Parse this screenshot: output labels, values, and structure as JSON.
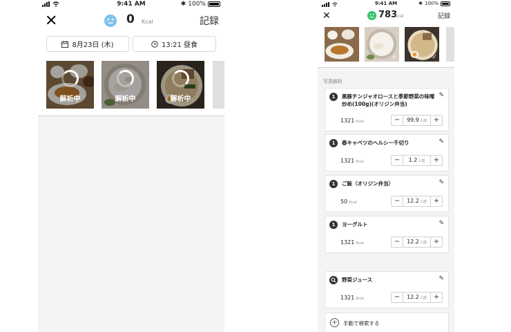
{
  "status": {
    "time": "9:41 AM",
    "battery": "100%"
  },
  "screen1": {
    "close_icon": "✕",
    "kcal_value": "0",
    "kcal_unit": "Kcal",
    "record_label": "記録",
    "date_label": "8月23日 (木)",
    "time_label": "13:21 昼食",
    "thumbnails": [
      {
        "label": "解析中"
      },
      {
        "label": "解析中"
      },
      {
        "label": "解析中"
      }
    ]
  },
  "screen2": {
    "close_icon": "✕",
    "kcal_value": "783",
    "kcal_unit": "Kcal",
    "record_label": "記録",
    "section_label": "写真解析",
    "items": [
      {
        "badge": "1",
        "name": "黒豚チンジャオロースと季節野菜の味噌炒め(100g)(オリジン弁当)",
        "kcal": "1321",
        "kcal_unit": "Kcal",
        "amount": "99.9",
        "amount_unit": "人前"
      },
      {
        "badge": "1",
        "name": "春キャベツのヘルシー千切り",
        "kcal": "1321",
        "kcal_unit": "Kcal",
        "amount": "1.2",
        "amount_unit": "人前"
      },
      {
        "badge": "1",
        "name": "ご飯（オリジン弁当）",
        "kcal": "50",
        "kcal_unit": "Kcal",
        "amount": "12.2",
        "amount_unit": "人前"
      },
      {
        "badge": "1",
        "name": "ヨーグルト",
        "kcal": "1321",
        "kcal_unit": "Kcal",
        "amount": "12.2",
        "amount_unit": "人前"
      },
      {
        "badge": "search",
        "name": "野菜ジュース",
        "kcal": "1321",
        "kcal_unit": "Kcal",
        "amount": "12.2",
        "amount_unit": "人前"
      }
    ],
    "manual_search_label": "手動で検索する"
  },
  "colors": {
    "neutral_face": "#7ec4ee",
    "happy_face": "#35c36a",
    "background": "#f4f4f4"
  }
}
